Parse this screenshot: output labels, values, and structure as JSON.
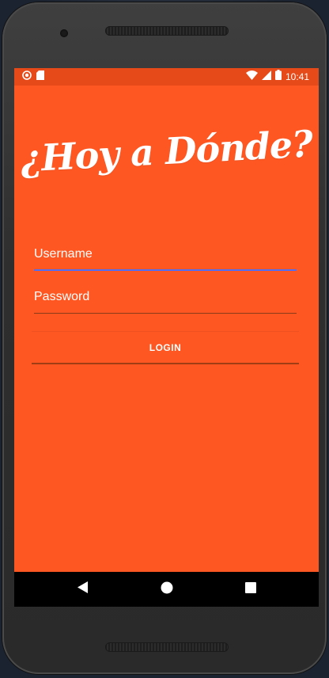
{
  "status_bar": {
    "time": "10:41",
    "icons": [
      "circle-notification-icon",
      "sd-card-icon",
      "wifi-icon",
      "cell-signal-icon",
      "battery-icon"
    ]
  },
  "app": {
    "logo_text": "¿Hoy a Dónde?",
    "background_color": "#ff5722",
    "status_bar_color": "#e64a19",
    "focus_accent_color": "#4f6ef7"
  },
  "form": {
    "username": {
      "value": "",
      "placeholder": "Username"
    },
    "password": {
      "value": "",
      "placeholder": "Password"
    },
    "login_label": "LOGIN"
  },
  "nav_bar": {
    "icons": [
      "back-icon",
      "home-icon",
      "recents-icon"
    ]
  }
}
